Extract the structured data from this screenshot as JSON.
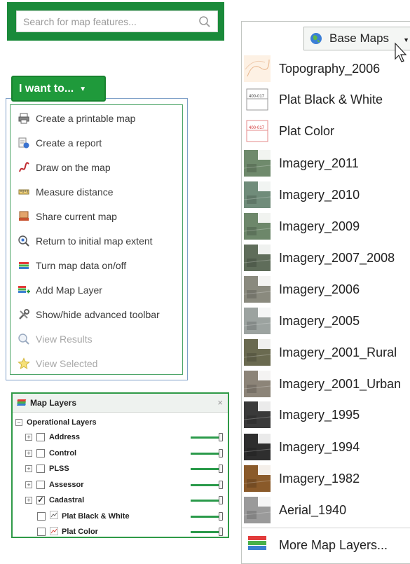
{
  "search": {
    "placeholder": "Search for map features..."
  },
  "iwant": {
    "button_label": "I want to...",
    "items": [
      {
        "label": "Create a printable map",
        "icon": "printer-icon",
        "disabled": false
      },
      {
        "label": "Create a report",
        "icon": "report-icon",
        "disabled": false
      },
      {
        "label": "Draw on the map",
        "icon": "draw-icon",
        "disabled": false
      },
      {
        "label": "Measure distance",
        "icon": "ruler-icon",
        "disabled": false
      },
      {
        "label": "Share current map",
        "icon": "share-icon",
        "disabled": false
      },
      {
        "label": "Return to initial map extent",
        "icon": "zoom-extent-icon",
        "disabled": false
      },
      {
        "label": "Turn map data on/off",
        "icon": "layers-icon",
        "disabled": false
      },
      {
        "label": "Add Map Layer",
        "icon": "add-layer-icon",
        "disabled": false
      },
      {
        "label": "Show/hide advanced toolbar",
        "icon": "tools-icon",
        "disabled": false
      },
      {
        "label": "View Results",
        "icon": "magnifier-icon",
        "disabled": true
      },
      {
        "label": "View Selected",
        "icon": "star-icon",
        "disabled": true
      }
    ]
  },
  "map_layers": {
    "title": "Map Layers",
    "close": "×",
    "group_label": "Operational Layers",
    "layers": [
      {
        "label": "Address",
        "checked": false,
        "expandable": true,
        "opacity": 1.0
      },
      {
        "label": "Control",
        "checked": false,
        "expandable": true,
        "opacity": 1.0
      },
      {
        "label": "PLSS",
        "checked": false,
        "expandable": true,
        "opacity": 1.0
      },
      {
        "label": "Assessor",
        "checked": false,
        "expandable": true,
        "opacity": 1.0
      },
      {
        "label": "Cadastral",
        "checked": true,
        "expandable": true,
        "opacity": 1.0
      },
      {
        "label": "Plat Black & White",
        "checked": false,
        "expandable": false,
        "opacity": 1.0
      },
      {
        "label": "Plat Color",
        "checked": false,
        "expandable": false,
        "opacity": 1.0
      }
    ]
  },
  "base_maps": {
    "button_label": "Base Maps",
    "items": [
      {
        "label": "Topography_2006",
        "thumb": "topo"
      },
      {
        "label": "Plat Black & White",
        "thumb": "plat-bw"
      },
      {
        "label": "Plat Color",
        "thumb": "plat-color"
      },
      {
        "label": "Imagery_2011",
        "thumb": "imagery"
      },
      {
        "label": "Imagery_2010",
        "thumb": "imagery"
      },
      {
        "label": "Imagery_2009",
        "thumb": "imagery"
      },
      {
        "label": "Imagery_2007_2008",
        "thumb": "imagery"
      },
      {
        "label": "Imagery_2006",
        "thumb": "imagery"
      },
      {
        "label": "Imagery_2005",
        "thumb": "imagery"
      },
      {
        "label": "Imagery_2001_Rural",
        "thumb": "imagery"
      },
      {
        "label": "Imagery_2001_Urban",
        "thumb": "imagery"
      },
      {
        "label": "Imagery_1995",
        "thumb": "imagery-bw"
      },
      {
        "label": "Imagery_1994",
        "thumb": "imagery-bw"
      },
      {
        "label": "Imagery_1982",
        "thumb": "imagery-brown"
      },
      {
        "label": "Aerial_1940",
        "thumb": "imagery-gray"
      }
    ],
    "more_label": "More Map Layers..."
  },
  "colors": {
    "brand_green": "#1f9a3b",
    "panel_border": "#7fa0c8"
  }
}
